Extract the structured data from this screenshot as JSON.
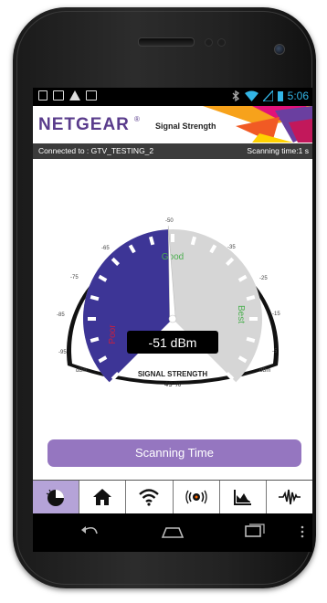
{
  "status_bar": {
    "time": "5:06",
    "left_icons": [
      "sim-icon",
      "image-icon",
      "warning-icon",
      "video-icon"
    ],
    "right_icons": [
      "bluetooth-icon",
      "wifi-icon",
      "signal-icon",
      "battery-icon"
    ]
  },
  "header": {
    "brand": "NETGEAR",
    "brand_mark": "®",
    "title": "Signal Strength"
  },
  "info_bar": {
    "connected": "Connected to : GTV_TESTING_2",
    "scanning": "Scanning time:1 s"
  },
  "gauge": {
    "ticks": [
      "-95",
      "-85",
      "-75",
      "-65",
      "-50",
      "-35",
      "-25",
      "-15",
      "-5"
    ],
    "unit_left": "dBm",
    "unit_right": "dBm",
    "zone_poor": "Poor",
    "zone_good": "Good",
    "zone_best": "Best",
    "reading": "-51 dBm",
    "label": "SIGNAL STRENGTH",
    "percent": "49 %",
    "percent_value": 49,
    "colors": {
      "filled": "#3d3596",
      "track": "#d6d6d6",
      "needle": "#ffffff"
    }
  },
  "scan_button": {
    "label": "Scanning Time"
  },
  "tabs": [
    {
      "icon": "gauge-icon",
      "active": true
    },
    {
      "icon": "home-icon",
      "active": false
    },
    {
      "icon": "wifi-icon",
      "active": false
    },
    {
      "icon": "signal-broadcast-icon",
      "active": false
    },
    {
      "icon": "chart-icon",
      "active": false
    },
    {
      "icon": "waveform-icon",
      "active": false
    }
  ],
  "nav_bar": [
    "back-icon",
    "home-icon",
    "recent-apps-icon",
    "menu-icon"
  ]
}
